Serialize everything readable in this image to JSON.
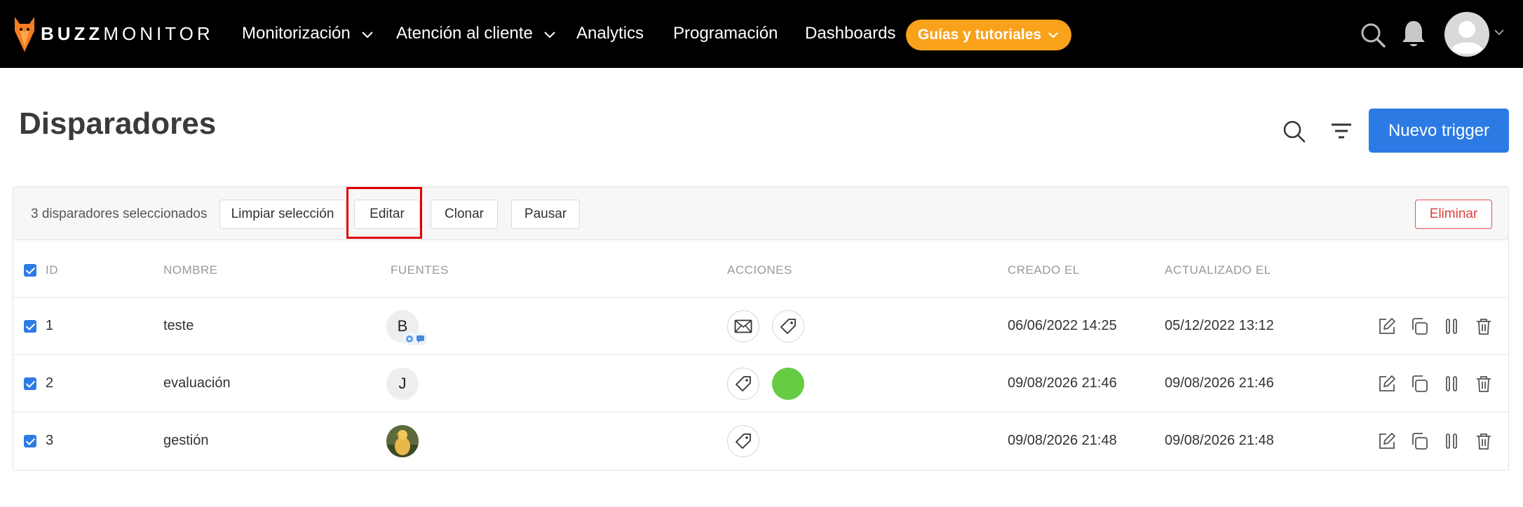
{
  "nav": {
    "logo_bold": "BUZZ",
    "logo_light": "MONITOR",
    "items": [
      {
        "label": "Monitorización",
        "dropdown": true
      },
      {
        "label": "Atención al cliente",
        "dropdown": true
      },
      {
        "label": "Analytics",
        "dropdown": false
      },
      {
        "label": "Programación",
        "dropdown": false
      },
      {
        "label": "Dashboards",
        "dropdown": false
      }
    ],
    "highlight_button": "Guías y tutoriales",
    "icons": [
      "search-icon",
      "bell-icon",
      "avatar",
      "chevron-down-icon"
    ]
  },
  "page": {
    "title": "Disparadores",
    "primary_button": "Nuevo trigger",
    "icons": [
      "search-icon",
      "filter-icon"
    ]
  },
  "selection_bar": {
    "text": "3 disparadores seleccionados",
    "buttons": [
      "Limpiar selección",
      "Editar",
      "Clonar",
      "Pausar"
    ],
    "danger_button": "Eliminar"
  },
  "table": {
    "headers": [
      "ID",
      "NOMBRE",
      "FUENTES",
      "ACCIONES",
      "CREADO EL",
      "ACTUALIZADO EL"
    ],
    "rows": [
      {
        "id": "1",
        "name": "teste",
        "source": "B",
        "source_badge": true,
        "actions": [
          "mail-icon",
          "tag-icon"
        ],
        "created": "06/06/2022 14:25",
        "updated": "05/12/2022 13:12",
        "checked": true
      },
      {
        "id": "2",
        "name": "evaluación",
        "source": "J",
        "source_badge": false,
        "actions": [
          "tag-icon",
          "green-dot"
        ],
        "created": "09/08/2026 21:46",
        "updated": "09/08/2026 21:46",
        "checked": true
      },
      {
        "id": "3",
        "name": "gestión",
        "source": "",
        "source_badge": false,
        "actions": [
          "tag-icon"
        ],
        "created": "09/08/2026 21:48",
        "updated": "09/08/2026 21:48",
        "checked": true
      }
    ],
    "row_icons": [
      "edit-icon",
      "clone-icon",
      "pause-icon",
      "trash-icon"
    ]
  },
  "colors": {
    "nav_bg": "#000000",
    "accent_orange": "#f9a11b",
    "primary_blue": "#2c7be5",
    "danger_red": "#e04040",
    "highlight_box": "#e00000",
    "green_action": "#66cc44"
  }
}
